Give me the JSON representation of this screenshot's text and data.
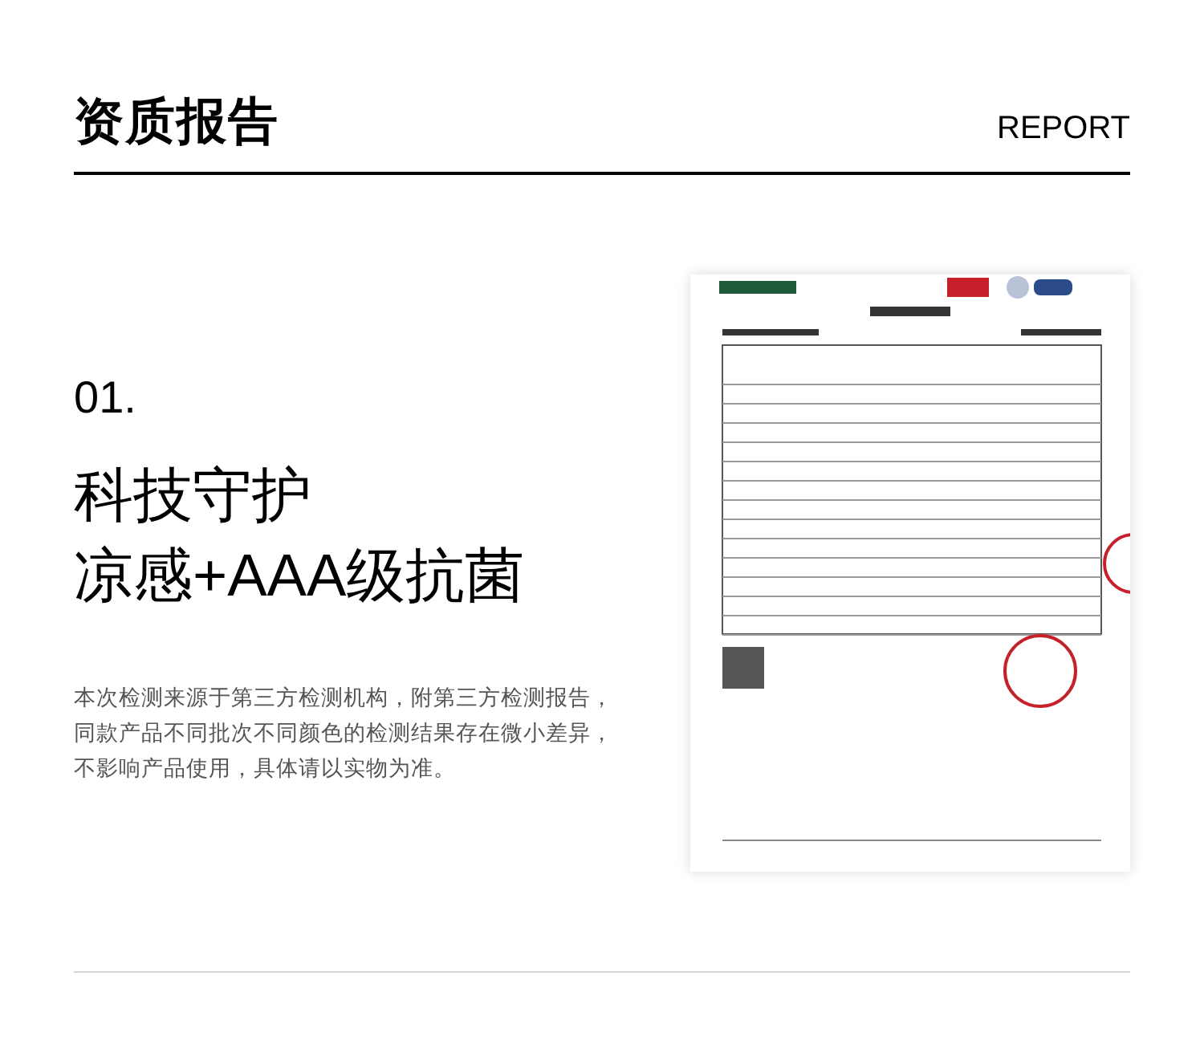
{
  "header": {
    "title": "资质报告",
    "subtitle": "REPORT"
  },
  "section": {
    "number": "01.",
    "headline": [
      "科技守护",
      "凉感+AAA级抗菌"
    ],
    "note": "本次检测来源于第三方检测机构，附第三方检测报告，同款产品不同批次不同颜色的检测结果存在微小差异，不影响产品使用，具体请以实物为准。"
  }
}
